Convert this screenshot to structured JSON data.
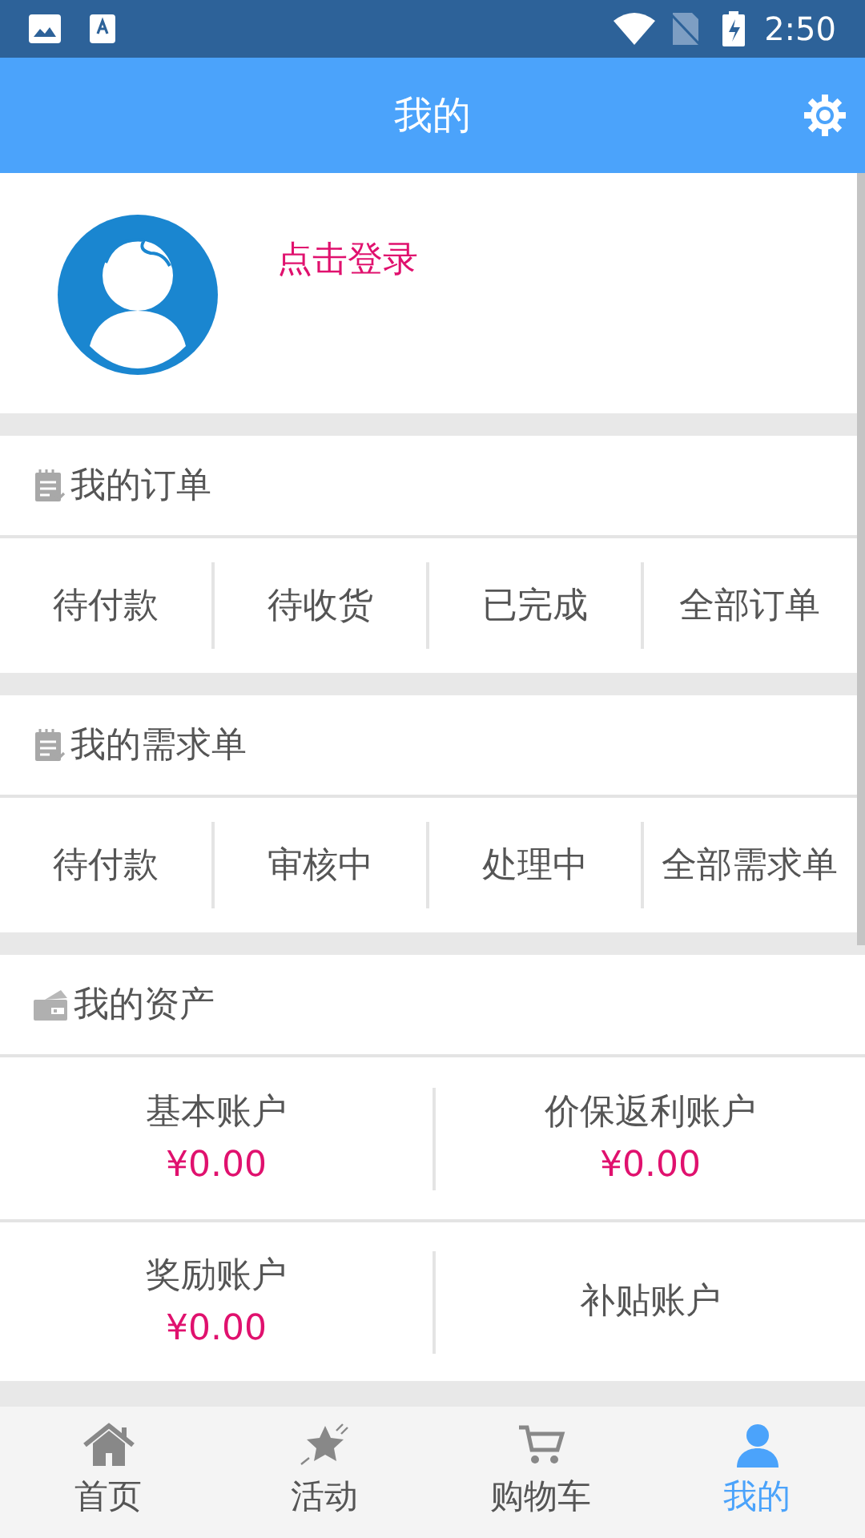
{
  "status_bar": {
    "time": "2:50"
  },
  "header": {
    "title": "我的"
  },
  "profile": {
    "login_link": "点击登录"
  },
  "sections": [
    {
      "kind": "links",
      "title": "我的订单",
      "items": [
        "待付款",
        "待收货",
        "已完成",
        "全部订单"
      ]
    },
    {
      "kind": "links",
      "title": "我的需求单",
      "items": [
        "待付款",
        "审核中",
        "处理中",
        "全部需求单"
      ]
    },
    {
      "kind": "accounts",
      "title": "我的资产",
      "accounts": [
        {
          "label": "基本账户",
          "value": "¥0.00"
        },
        {
          "label": "价保返利账户",
          "value": "¥0.00"
        },
        {
          "label": "奖励账户",
          "value": "¥0.00"
        },
        {
          "label": "补贴账户"
        }
      ]
    }
  ],
  "bottom_nav": [
    {
      "label": "首页",
      "selected": false
    },
    {
      "label": "活动",
      "selected": false
    },
    {
      "label": "购物车",
      "selected": false
    },
    {
      "label": "我的",
      "selected": true
    }
  ]
}
